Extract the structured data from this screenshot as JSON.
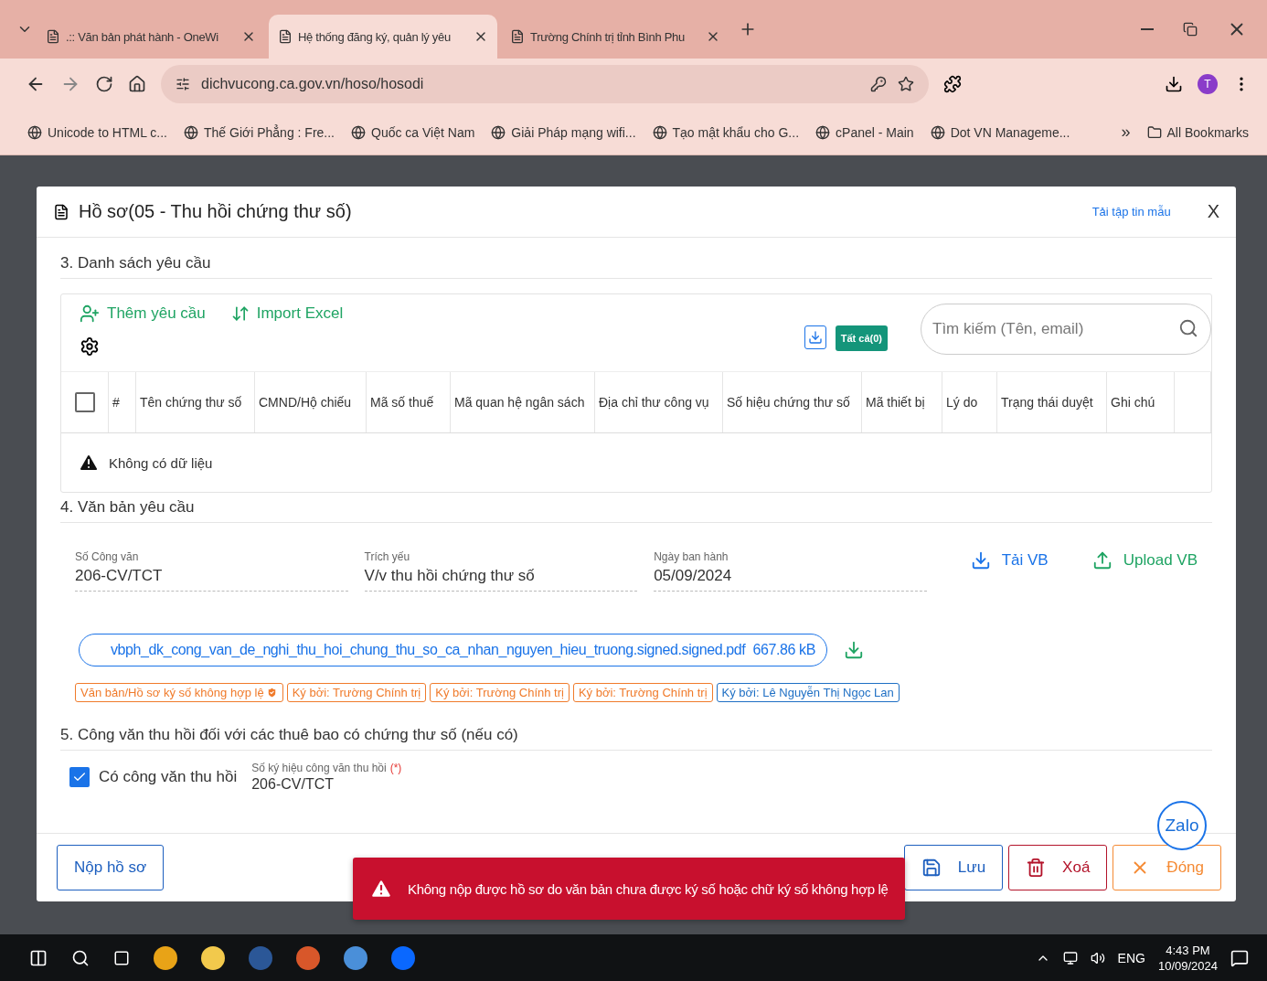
{
  "browser": {
    "tabs": [
      {
        "title": ".:: Văn bản phát hành - OneWi",
        "selected": false
      },
      {
        "title": "Hệ thống đăng ký, quản lý yêu",
        "selected": true
      },
      {
        "title": "Trường Chính trị tỉnh Bình Phu",
        "selected": false
      }
    ],
    "address": "dichvucong.ca.gov.vn/hoso/hosodi",
    "profile": "T",
    "bookmarks": [
      "Unicode to HTML c...",
      "Thế Giới Phẳng : Fre...",
      "Quốc ca Việt Nam",
      "Giải Pháp mạng wifi...",
      "Tạo mật khẩu cho G...",
      "cPanel - Main",
      "Dot VN Manageme..."
    ],
    "more": "»",
    "all_bookmarks": "All Bookmarks"
  },
  "modal": {
    "title": "Hồ sơ(05 - Thu hồi chứng thư số)",
    "template_link": "Tải tập tin mẫu",
    "close": "X",
    "section3": {
      "title": "3. Danh sách yêu cầu",
      "add": "Thêm yêu cầu",
      "import": "Import Excel",
      "filter": "Tất cả(0)",
      "search_placeholder": "Tìm kiếm (Tên, email)",
      "select_all_checked": false,
      "columns": [
        "#",
        "Tên chứng thư số",
        "CMND/Hộ chiếu",
        "Mã số thuế",
        "Mã quan hệ ngân sách",
        "Địa chỉ thư công vụ",
        "Số hiệu chứng thư số",
        "Mã thiết bị",
        "Lý do",
        "Trạng thái duyệt",
        "Ghi chú"
      ],
      "empty": "Không có dữ liệu"
    },
    "section4": {
      "title": "4. Văn bản yêu cầu",
      "fields": [
        {
          "label": "Số Công văn",
          "value": "206-CV/TCT"
        },
        {
          "label": "Trích yếu",
          "value": "V/v thu hồi chứng thư số"
        },
        {
          "label": "Ngày ban hành",
          "value": "05/09/2024"
        }
      ],
      "download": "Tải VB",
      "upload": "Upload VB",
      "file": {
        "name": "vbph_dk_cong_van_de_nghi_thu_hoi_chung_thu_so_ca_nhan_nguyen_hieu_truong.signed.signed.pdf",
        "size": "667.86 kB"
      },
      "tags": [
        {
          "text": "Văn bản/Hồ sơ ký số không hợp lệ",
          "color": "#f07b2b",
          "shield": true
        },
        {
          "text": "Ký bởi: Trường Chính trị",
          "color": "#f07b2b",
          "shield": false
        },
        {
          "text": "Ký bởi: Trường Chính trị",
          "color": "#f07b2b",
          "shield": false
        },
        {
          "text": "Ký bởi: Trường Chính trị",
          "color": "#f07b2b",
          "shield": false
        },
        {
          "text": "Ký bởi: Lê Nguyễn Thị Ngọc Lan",
          "color": "#1e6fc4",
          "shield": false
        }
      ]
    },
    "section5": {
      "title": "5. Công văn thu hồi đối với các thuê bao có chứng thư số (nếu có)",
      "checkbox": {
        "label": "Có công văn thu hồi",
        "checked": true
      },
      "field": {
        "label": "Số ký hiệu công văn thu hồi",
        "required": "(*)",
        "value": "206-CV/TCT"
      }
    },
    "submit": "Nộp hồ sơ",
    "buttons": [
      {
        "kind": "save",
        "label": "Lưu"
      },
      {
        "kind": "delete",
        "label": "Xoá"
      },
      {
        "kind": "close",
        "label": "Đóng"
      }
    ]
  },
  "toast": "Không nộp được hồ sơ do văn bản chưa được ký số hoặc chữ ký số không hợp lệ",
  "zalo": "Zalo",
  "taskbar": {
    "language": "ENG",
    "time": "4:43 PM",
    "date": "10/09/2024"
  }
}
